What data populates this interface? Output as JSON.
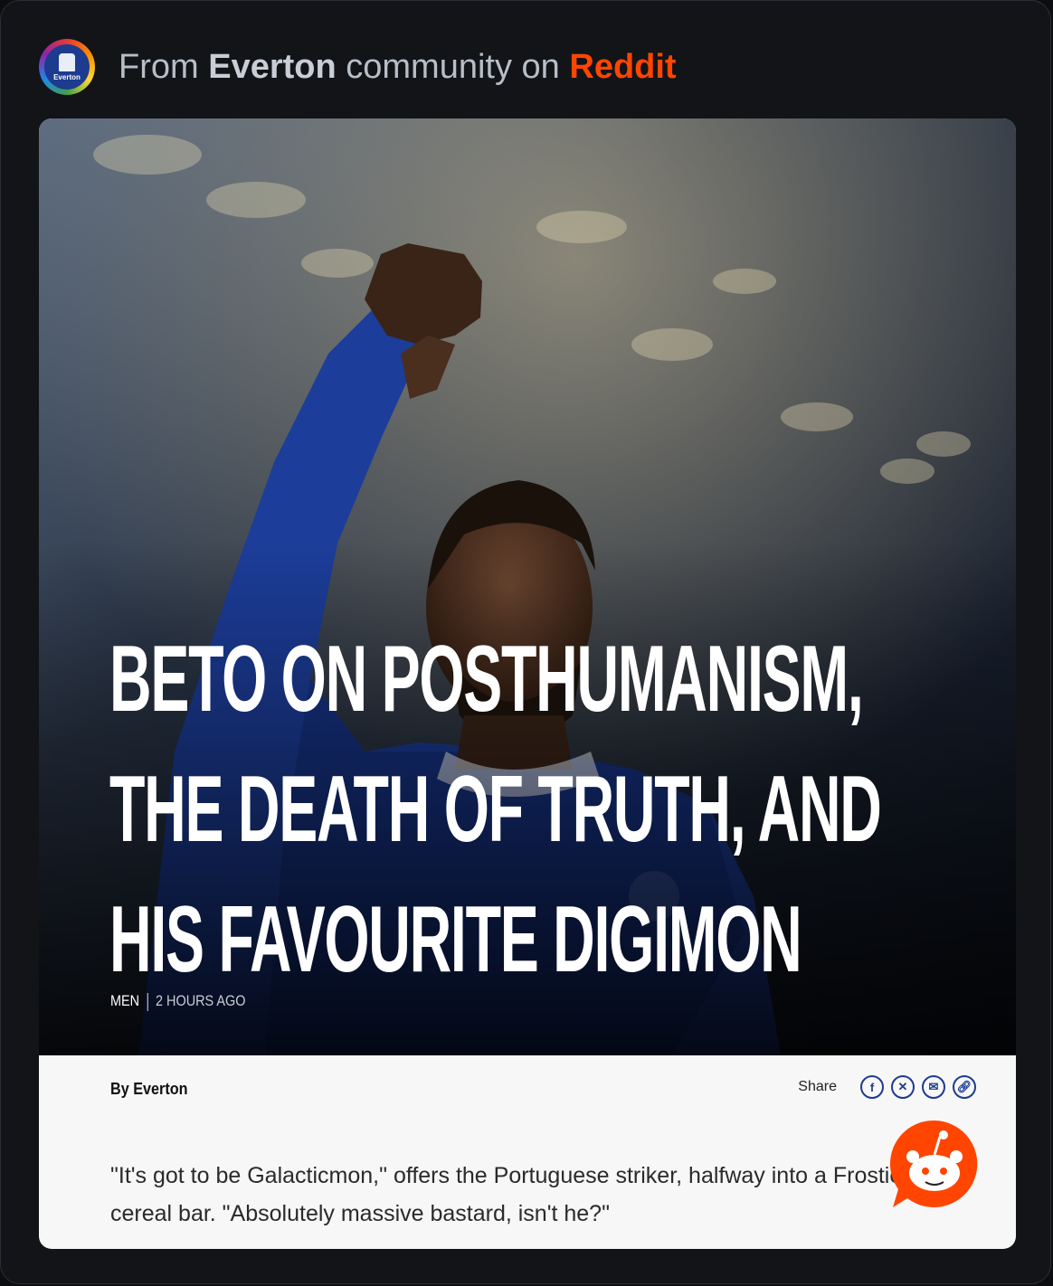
{
  "header": {
    "prefix": "From",
    "community": "Everton",
    "middle": "community on",
    "platform": "Reddit",
    "avatar_label": "Everton",
    "avatar_icon": "everton-crest-icon"
  },
  "article": {
    "headline": "BETO ON POSTHUMANISM, THE DEATH OF TRUTH, AND HIS FAVOURITE DIGIMON",
    "category": "MEN",
    "time": "2 HOURS AGO",
    "byline": "By Everton",
    "share_label": "Share",
    "share_icons": [
      "facebook-icon",
      "x-icon",
      "email-icon",
      "link-icon"
    ],
    "body": "\"It's got to be Galacticmon,\" offers the Portuguese striker, halfway into a Frosties cereal bar. \"Absolutely massive bastard, isn't he?\""
  },
  "colors": {
    "reddit": "#ff4500",
    "everton_blue": "#1d3b8f",
    "background": "#121417"
  }
}
